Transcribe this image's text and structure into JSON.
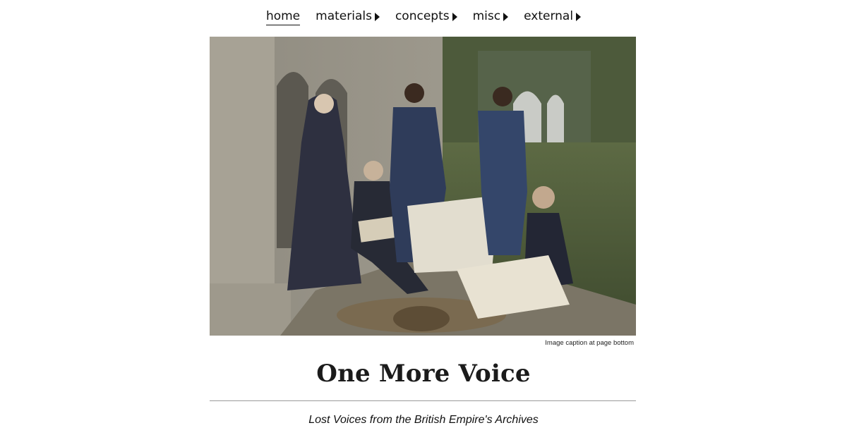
{
  "nav": {
    "items": [
      {
        "label": "home",
        "active": true,
        "has_submenu": false
      },
      {
        "label": "materials",
        "active": false,
        "has_submenu": true
      },
      {
        "label": "concepts",
        "active": false,
        "has_submenu": true
      },
      {
        "label": "misc",
        "active": false,
        "has_submenu": true
      },
      {
        "label": "external",
        "active": false,
        "has_submenu": true
      }
    ],
    "submenu_icon": "caret-right-icon"
  },
  "hero": {
    "caption": "Image caption at page bottom"
  },
  "site": {
    "title": "One More Voice",
    "subtitle": "Lost Voices from the British Empire's Archives"
  }
}
